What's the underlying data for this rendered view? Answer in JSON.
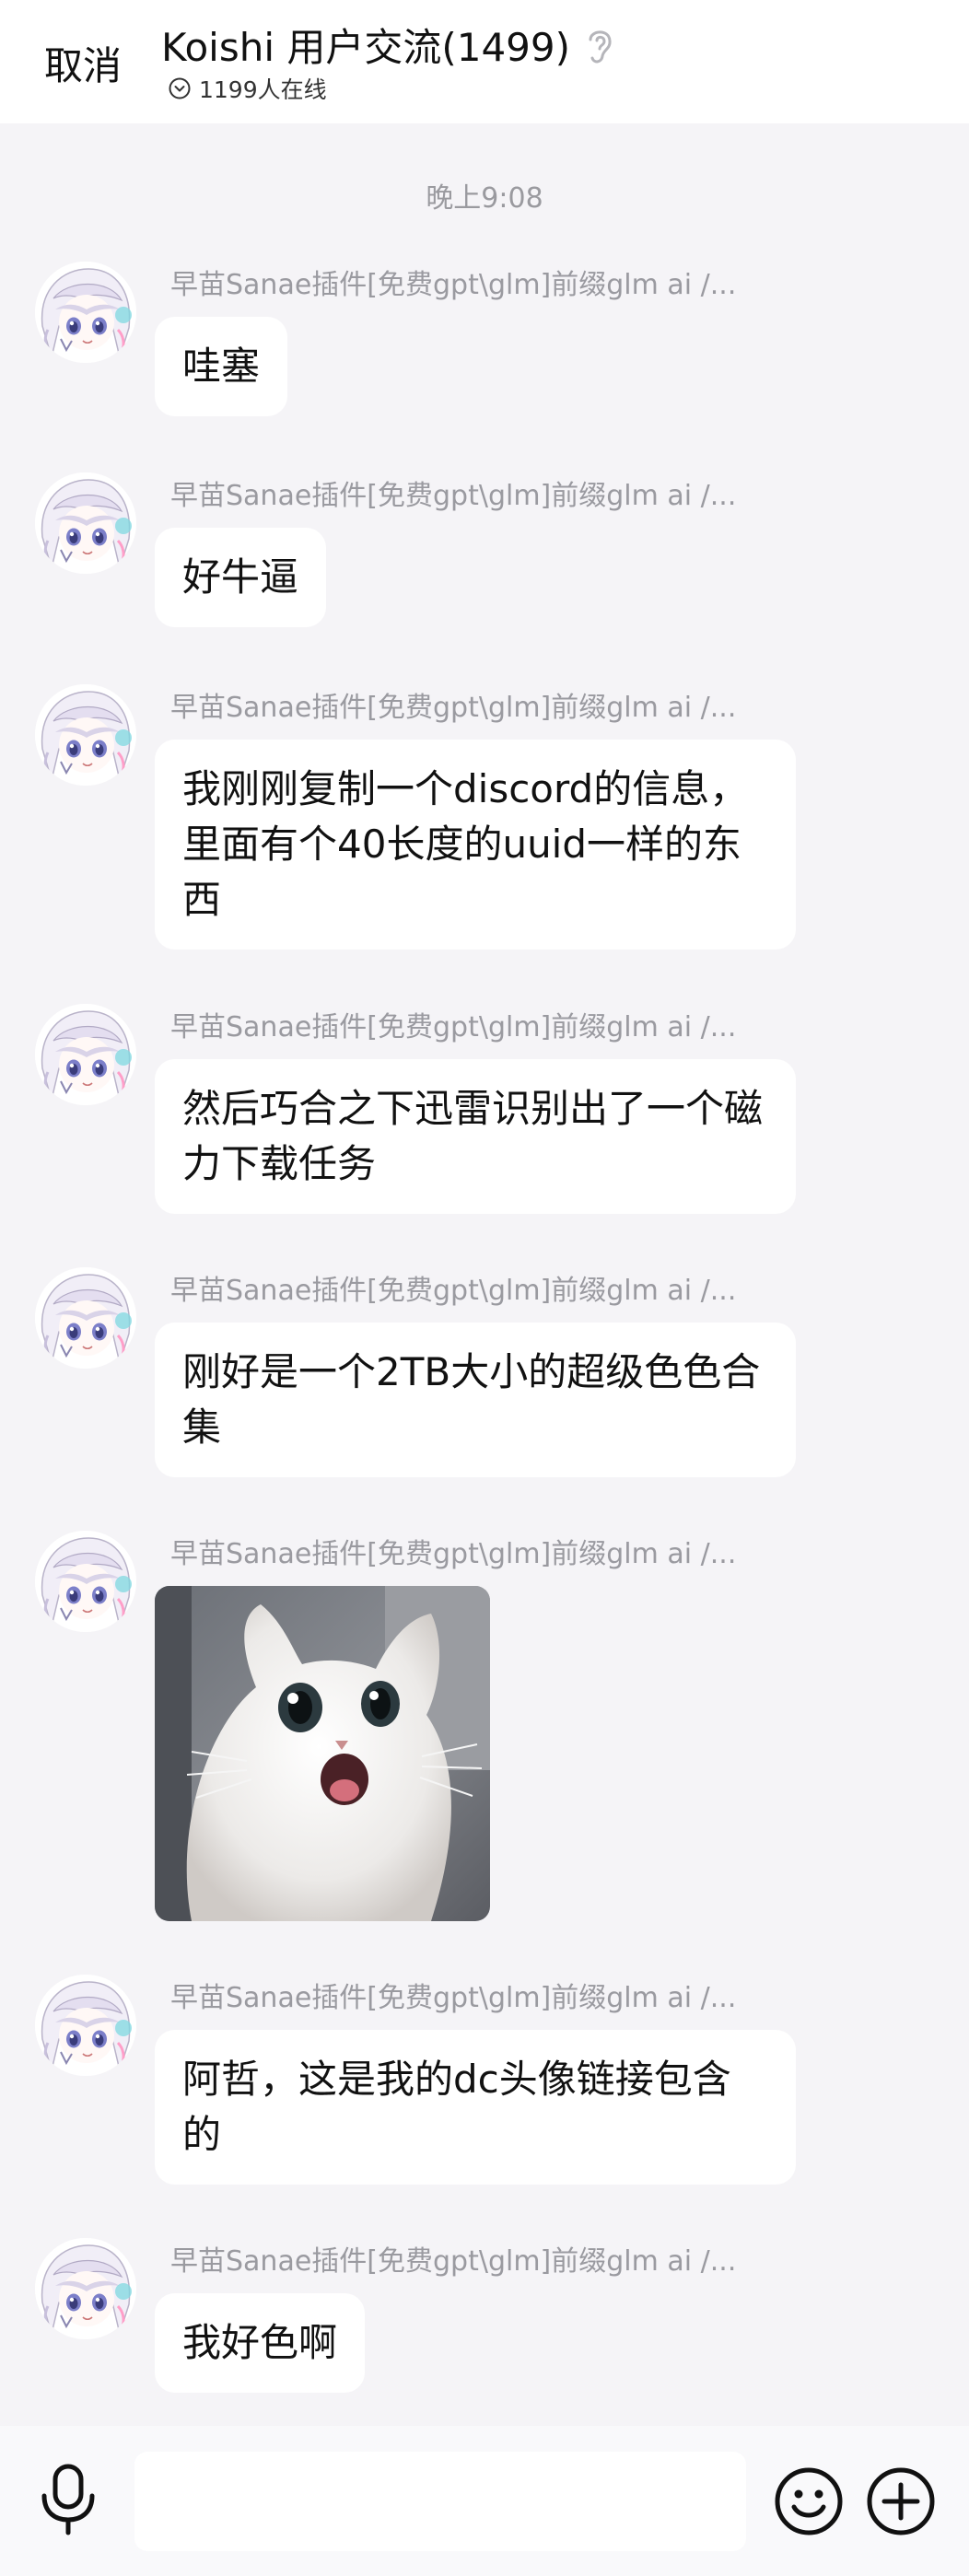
{
  "header": {
    "cancel_label": "取消",
    "title": "Koishi 用户交流(1499)",
    "online_text": "1199人在线"
  },
  "time_divider": "晚上9:08",
  "sender_name": "早苗Sanae插件[免费gpt\\glm]前缀glm ai /...",
  "messages": [
    {
      "type": "text",
      "text": "哇塞"
    },
    {
      "type": "text",
      "text": "好牛逼"
    },
    {
      "type": "text",
      "text": "我刚刚复制一个discord的信息，里面有个40长度的uuid一样的东西"
    },
    {
      "type": "text",
      "text": "然后巧合之下迅雷识别出了一个磁力下载任务"
    },
    {
      "type": "text",
      "text": "刚好是一个2TB大小的超级色色合集"
    },
    {
      "type": "image",
      "content": "white-cat-photo"
    },
    {
      "type": "text",
      "text": "阿哲，这是我的dc头像链接包含的"
    },
    {
      "type": "text",
      "text": "我好色啊"
    }
  ],
  "footer": {
    "input_placeholder": "",
    "icons": [
      "microphone-icon",
      "emoji-icon",
      "plus-icon"
    ]
  },
  "colors": {
    "background": "#f5f4f7",
    "bubble": "#ffffff",
    "meta_text": "#9a9aa0"
  }
}
